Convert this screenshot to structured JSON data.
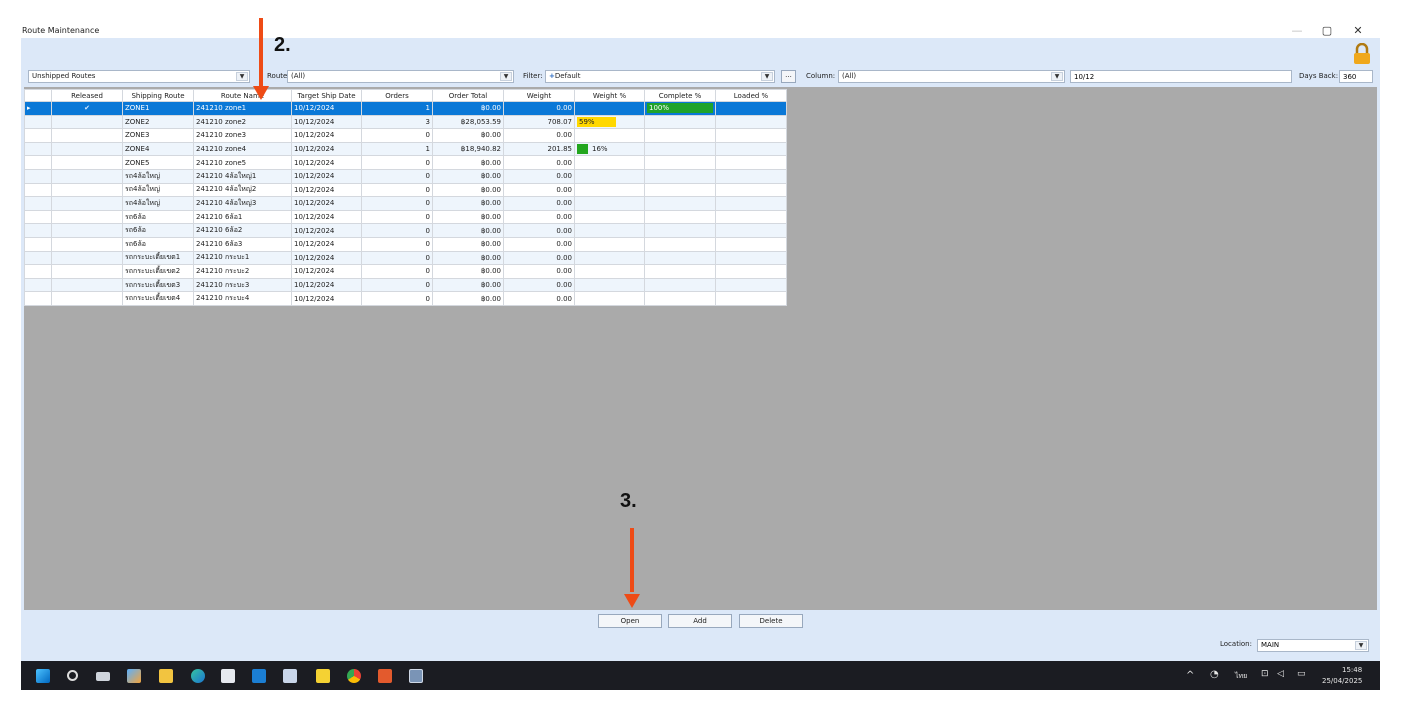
{
  "window": {
    "title": "Route Maintenance",
    "minimize_glyph": "—",
    "restore_glyph": "▢",
    "close_glyph": "✕"
  },
  "filters": {
    "status_value": "Unshipped Routes",
    "route_label": "Route:",
    "route_value": "(All)",
    "filter_label": "Filter:",
    "filter_value": "Default",
    "filter_icon": "plus-icon",
    "more_button": "...",
    "column_label": "Column:",
    "column_value": "(All)",
    "search_value": "10/12",
    "days_back_label": "Days Back:",
    "days_back_value": "360"
  },
  "grid": {
    "columns": [
      "",
      "Released",
      "Shipping Route",
      "Route Name",
      "Target Ship Date",
      "Orders",
      "Order Total",
      "Weight",
      "Weight %",
      "Complete %",
      "Loaded %"
    ],
    "rows": [
      {
        "indicator": "▸",
        "released": "✔",
        "route": "ZONE1",
        "name": "241210 zone1",
        "date": "10/12/2024",
        "orders": "1",
        "total": "฿0.00",
        "weight": "0.00",
        "weight_pct": "",
        "weight_pct_value": 0,
        "complete_pct": "100%",
        "complete_pct_value": 100,
        "loaded": "",
        "selected": true
      },
      {
        "indicator": "",
        "released": "",
        "route": "ZONE2",
        "name": "241210 zone2",
        "date": "10/12/2024",
        "orders": "3",
        "total": "฿28,053.59",
        "weight": "708.07",
        "weight_pct": "59%",
        "weight_pct_value": 59,
        "complete_pct": "",
        "complete_pct_value": 0,
        "loaded": "",
        "selected": false
      },
      {
        "indicator": "",
        "released": "",
        "route": "ZONE3",
        "name": "241210 zone3",
        "date": "10/12/2024",
        "orders": "0",
        "total": "฿0.00",
        "weight": "0.00",
        "weight_pct": "",
        "weight_pct_value": 0,
        "complete_pct": "",
        "complete_pct_value": 0,
        "loaded": "",
        "selected": false
      },
      {
        "indicator": "",
        "released": "",
        "route": "ZONE4",
        "name": "241210 zone4",
        "date": "10/12/2024",
        "orders": "1",
        "total": "฿18,940.82",
        "weight": "201.85",
        "weight_pct": "16%",
        "weight_pct_value": 16,
        "complete_pct": "",
        "complete_pct_value": 0,
        "loaded": "",
        "selected": false
      },
      {
        "indicator": "",
        "released": "",
        "route": "ZONE5",
        "name": "241210 zone5",
        "date": "10/12/2024",
        "orders": "0",
        "total": "฿0.00",
        "weight": "0.00",
        "weight_pct": "",
        "weight_pct_value": 0,
        "complete_pct": "",
        "complete_pct_value": 0,
        "loaded": "",
        "selected": false
      },
      {
        "indicator": "",
        "released": "",
        "route": "รถ4ล้อใหญ่",
        "name": "241210 4ล้อใหญ่1",
        "date": "10/12/2024",
        "orders": "0",
        "total": "฿0.00",
        "weight": "0.00",
        "weight_pct": "",
        "weight_pct_value": 0,
        "complete_pct": "",
        "complete_pct_value": 0,
        "loaded": "",
        "selected": false
      },
      {
        "indicator": "",
        "released": "",
        "route": "รถ4ล้อใหญ่",
        "name": "241210 4ล้อใหญ่2",
        "date": "10/12/2024",
        "orders": "0",
        "total": "฿0.00",
        "weight": "0.00",
        "weight_pct": "",
        "weight_pct_value": 0,
        "complete_pct": "",
        "complete_pct_value": 0,
        "loaded": "",
        "selected": false
      },
      {
        "indicator": "",
        "released": "",
        "route": "รถ4ล้อใหญ่",
        "name": "241210 4ล้อใหญ่3",
        "date": "10/12/2024",
        "orders": "0",
        "total": "฿0.00",
        "weight": "0.00",
        "weight_pct": "",
        "weight_pct_value": 0,
        "complete_pct": "",
        "complete_pct_value": 0,
        "loaded": "",
        "selected": false
      },
      {
        "indicator": "",
        "released": "",
        "route": "รถ6ล้อ",
        "name": "241210 6ล้อ1",
        "date": "10/12/2024",
        "orders": "0",
        "total": "฿0.00",
        "weight": "0.00",
        "weight_pct": "",
        "weight_pct_value": 0,
        "complete_pct": "",
        "complete_pct_value": 0,
        "loaded": "",
        "selected": false
      },
      {
        "indicator": "",
        "released": "",
        "route": "รถ6ล้อ",
        "name": "241210 6ล้อ2",
        "date": "10/12/2024",
        "orders": "0",
        "total": "฿0.00",
        "weight": "0.00",
        "weight_pct": "",
        "weight_pct_value": 0,
        "complete_pct": "",
        "complete_pct_value": 0,
        "loaded": "",
        "selected": false
      },
      {
        "indicator": "",
        "released": "",
        "route": "รถ6ล้อ",
        "name": "241210 6ล้อ3",
        "date": "10/12/2024",
        "orders": "0",
        "total": "฿0.00",
        "weight": "0.00",
        "weight_pct": "",
        "weight_pct_value": 0,
        "complete_pct": "",
        "complete_pct_value": 0,
        "loaded": "",
        "selected": false
      },
      {
        "indicator": "",
        "released": "",
        "route": "รถกระบะเตี้ยเขต1",
        "name": "241210 กระบะ1",
        "date": "10/12/2024",
        "orders": "0",
        "total": "฿0.00",
        "weight": "0.00",
        "weight_pct": "",
        "weight_pct_value": 0,
        "complete_pct": "",
        "complete_pct_value": 0,
        "loaded": "",
        "selected": false
      },
      {
        "indicator": "",
        "released": "",
        "route": "รถกระบะเตี้ยเขต2",
        "name": "241210 กระบะ2",
        "date": "10/12/2024",
        "orders": "0",
        "total": "฿0.00",
        "weight": "0.00",
        "weight_pct": "",
        "weight_pct_value": 0,
        "complete_pct": "",
        "complete_pct_value": 0,
        "loaded": "",
        "selected": false
      },
      {
        "indicator": "",
        "released": "",
        "route": "รถกระบะเตี้ยเขต3",
        "name": "241210 กระบะ3",
        "date": "10/12/2024",
        "orders": "0",
        "total": "฿0.00",
        "weight": "0.00",
        "weight_pct": "",
        "weight_pct_value": 0,
        "complete_pct": "",
        "complete_pct_value": 0,
        "loaded": "",
        "selected": false
      },
      {
        "indicator": "",
        "released": "",
        "route": "รถกระบะเตี้ยเขต4",
        "name": "241210 กระบะ4",
        "date": "10/12/2024",
        "orders": "0",
        "total": "฿0.00",
        "weight": "0.00",
        "weight_pct": "",
        "weight_pct_value": 0,
        "complete_pct": "",
        "complete_pct_value": 0,
        "loaded": "",
        "selected": false
      }
    ]
  },
  "buttons": {
    "open": "Open",
    "add": "Add",
    "delete": "Delete"
  },
  "location": {
    "label": "Location:",
    "value": "MAIN"
  },
  "annotations": {
    "step2": "2.",
    "step3": "3."
  },
  "taskbar": {
    "icons": [
      "windows-start-icon",
      "search-icon",
      "task-view-icon",
      "widgets-icon",
      "file-explorer-icon",
      "edge-icon",
      "store-icon",
      "outlook-icon",
      "remote-desktop-icon",
      "sticky-notes-icon",
      "chrome-icon",
      "powerpoint-icon",
      "app-icon"
    ],
    "tray_chevron": "^",
    "language": "ไทย",
    "time": "15:48",
    "date": "25/04/2025"
  },
  "colors": {
    "selected_row": "#0a78d7",
    "weight_bar_yellow": "#ffd800",
    "weight_bar_green": "#23a61e",
    "complete_bar_green": "#1fa32b",
    "annotation_arrow": "#ee4b16"
  }
}
